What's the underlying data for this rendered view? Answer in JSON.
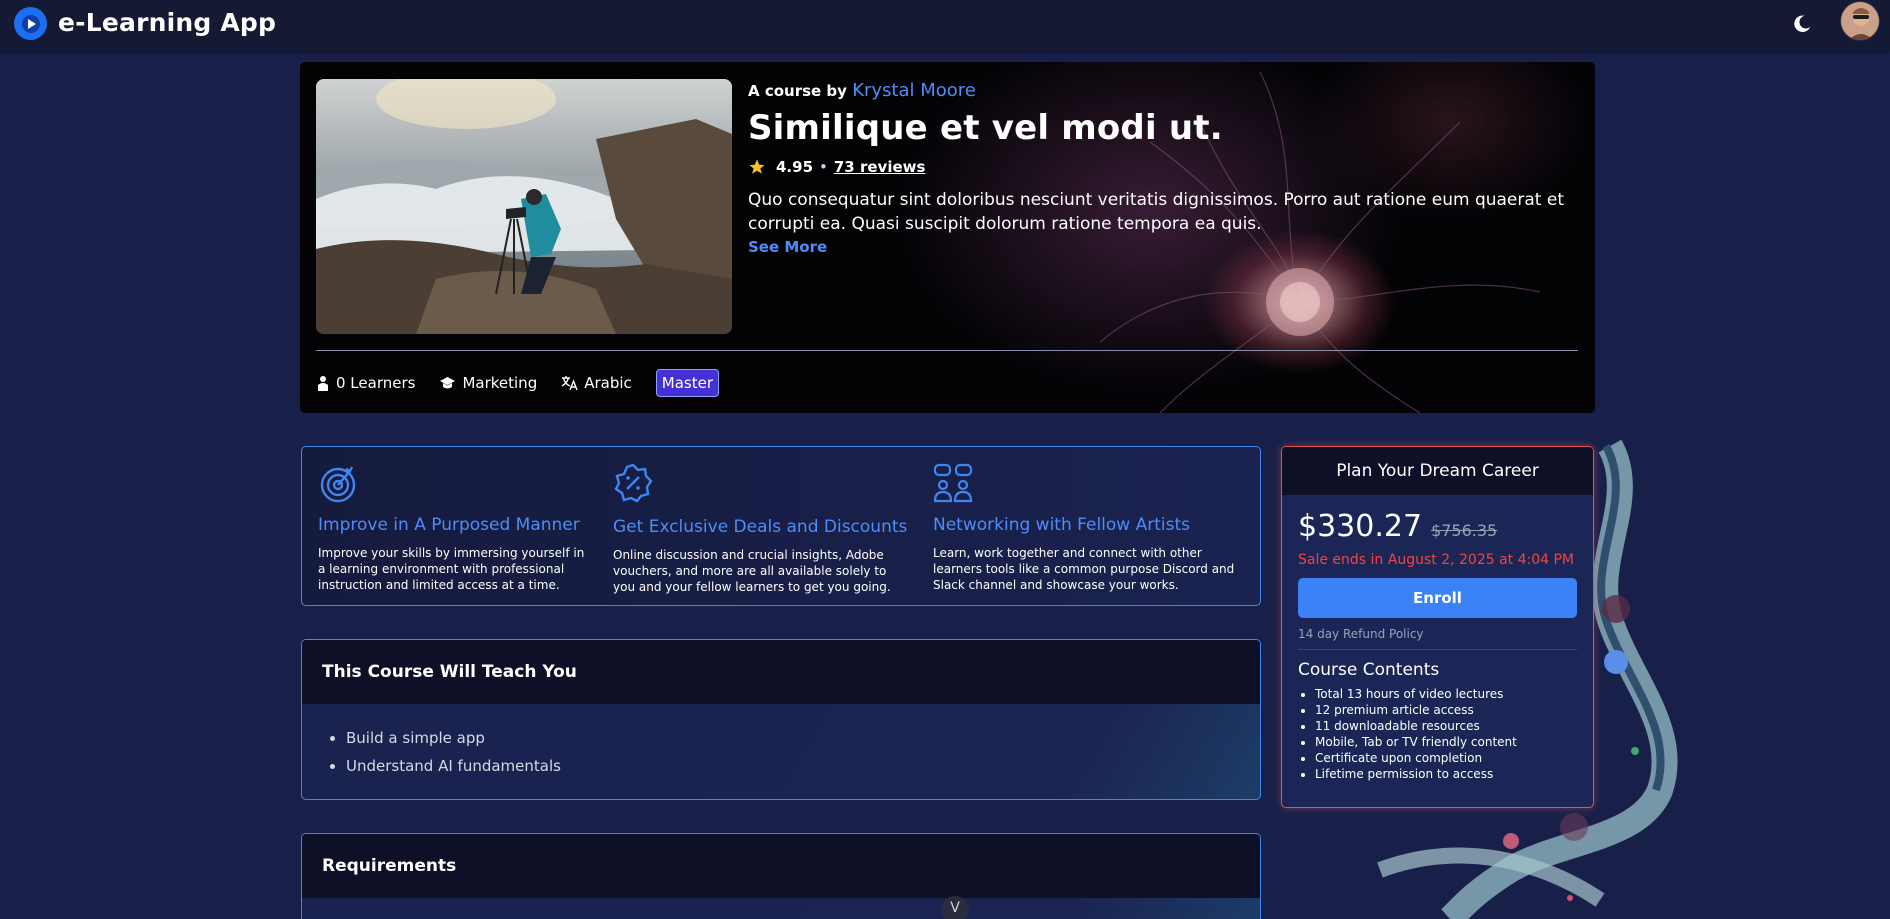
{
  "header": {
    "app_title": "e-Learning App",
    "logo_icon": "play-logo-icon",
    "theme_toggle_icon": "moon-icon",
    "avatar_icon": "user-avatar"
  },
  "course": {
    "byline_prefix": "A course by",
    "author": "Krystal Moore",
    "title": "Similique et vel modi ut.",
    "rating": "4.95",
    "separator": "•",
    "reviews": "73 reviews",
    "description": "Quo consequatur sint doloribus nesciunt veritatis dignissimos. Porro aut ratione eum quaerat et corrupti ea. Quasi suscipit dolorum ratione tempora ea quis.",
    "see_more": "See More",
    "meta": {
      "learners": "0 Learners",
      "category": "Marketing",
      "language": "Arabic",
      "level": "Master"
    }
  },
  "features": [
    {
      "icon": "target-icon",
      "title": "Improve in A Purposed Manner",
      "description": "Improve your skills by immersing yourself in a learning environment with professional instruction and limited access at a time."
    },
    {
      "icon": "discount-badge-icon",
      "title": "Get Exclusive Deals and Discounts",
      "description": "Online discussion and crucial insights, Adobe vouchers, and more are all available solely to you and your fellow learners to get you going."
    },
    {
      "icon": "people-chat-icon",
      "title": "Networking with Fellow Artists",
      "description": "Learn, work together and connect with other learners tools like a common purpose Discord and Slack channel and showcase your works."
    }
  ],
  "teach": {
    "title": "This Course Will Teach You",
    "items": [
      "Build a simple app",
      "Understand AI fundamentals"
    ]
  },
  "requirements": {
    "title": "Requirements"
  },
  "pricing": {
    "header": "Plan Your Dream Career",
    "price": "$330.27",
    "old_price": "$756.35",
    "sale_text": "Sale ends in August 2, 2025 at 4:04 PM",
    "enroll_label": "Enroll",
    "refund_policy": "14 day Refund Policy",
    "contents_title": "Course Contents",
    "contents": [
      "Total 13 hours of video lectures",
      "12 premium article access",
      "11 downloadable resources",
      "Mobile, Tab or TV friendly content",
      "Certificate upon completion",
      "Lifetime permission to access"
    ]
  },
  "scroll_button": "V",
  "colors": {
    "accent": "#4d8df8",
    "primary_button": "#3b82f6",
    "sale_red": "#f0453f",
    "level_badge": "#4530d6",
    "background": "#18204a"
  }
}
